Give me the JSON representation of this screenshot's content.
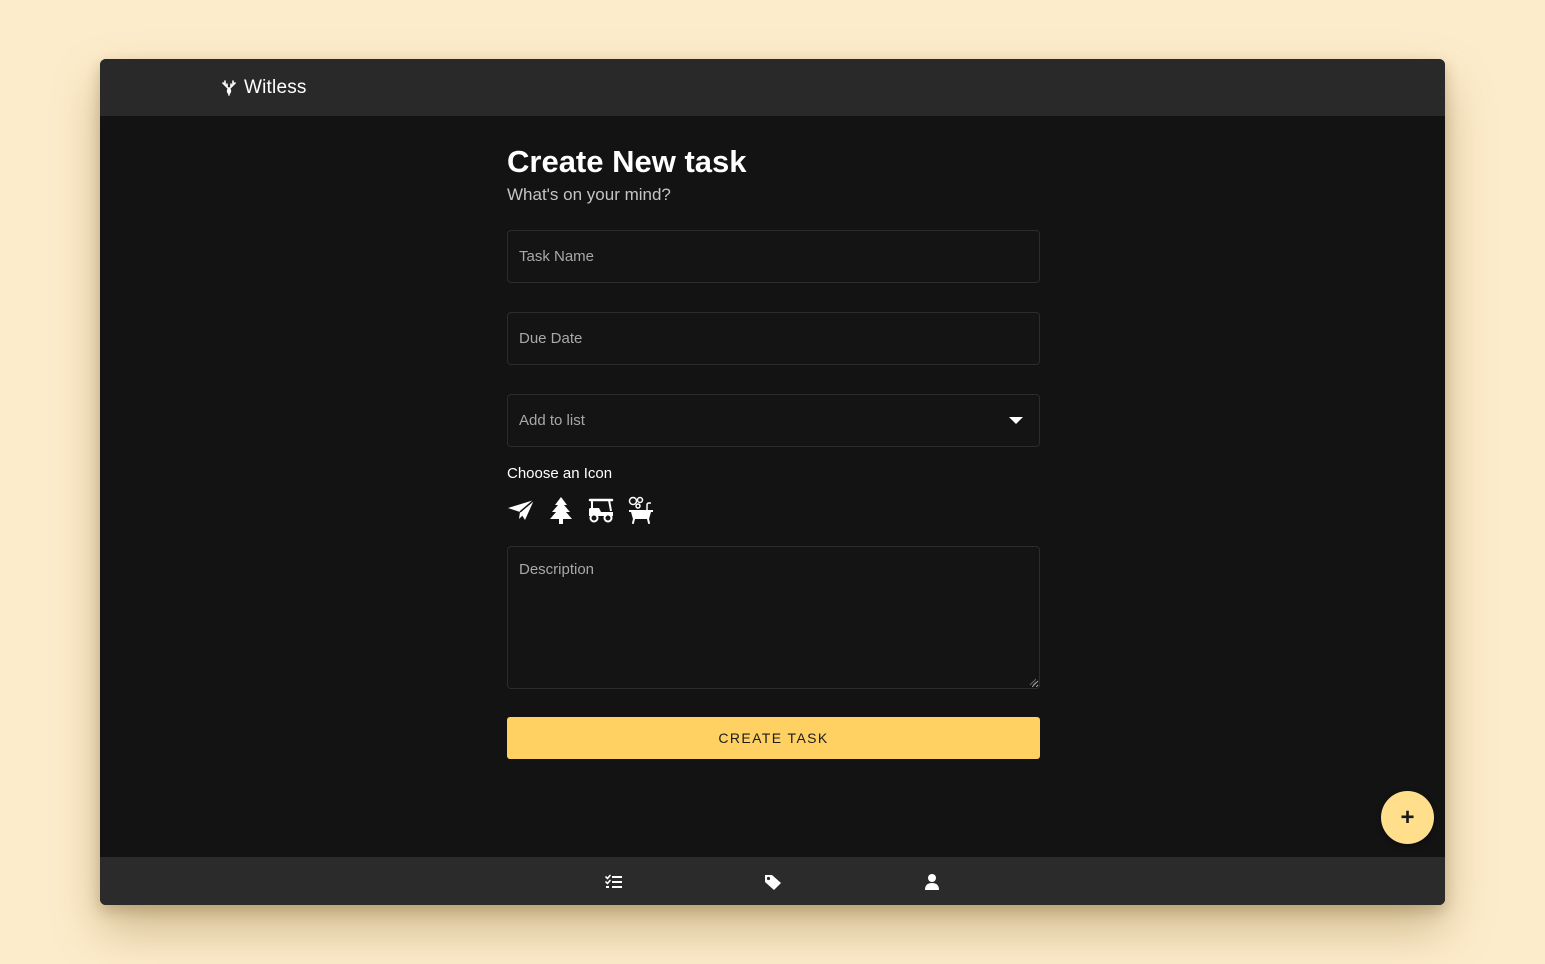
{
  "app": {
    "brand_name": "Witless",
    "brand_icon": "deer-antlers-icon"
  },
  "form": {
    "title": "Create New task",
    "subtitle": "What's on your mind?",
    "task_name_placeholder": "Task Name",
    "task_name_value": "",
    "due_date_placeholder": "Due Date",
    "due_date_value": "",
    "list_select_value": "Add to list",
    "icon_label": "Choose an Icon",
    "icons": [
      "paper-plane-icon",
      "tree-icon",
      "golf-cart-icon",
      "bathtub-icon"
    ],
    "description_placeholder": "Description",
    "description_value": "",
    "submit_label": "CREATE TASK"
  },
  "fab": {
    "label": "+"
  },
  "bottom_nav": {
    "items": [
      "tasks-list-icon",
      "tag-icon",
      "user-icon"
    ]
  },
  "colors": {
    "page_background": "#fdeccb",
    "app_background": "#131313",
    "bar_background": "#292929",
    "accent": "#ffd162",
    "fab": "#ffdf8c"
  }
}
